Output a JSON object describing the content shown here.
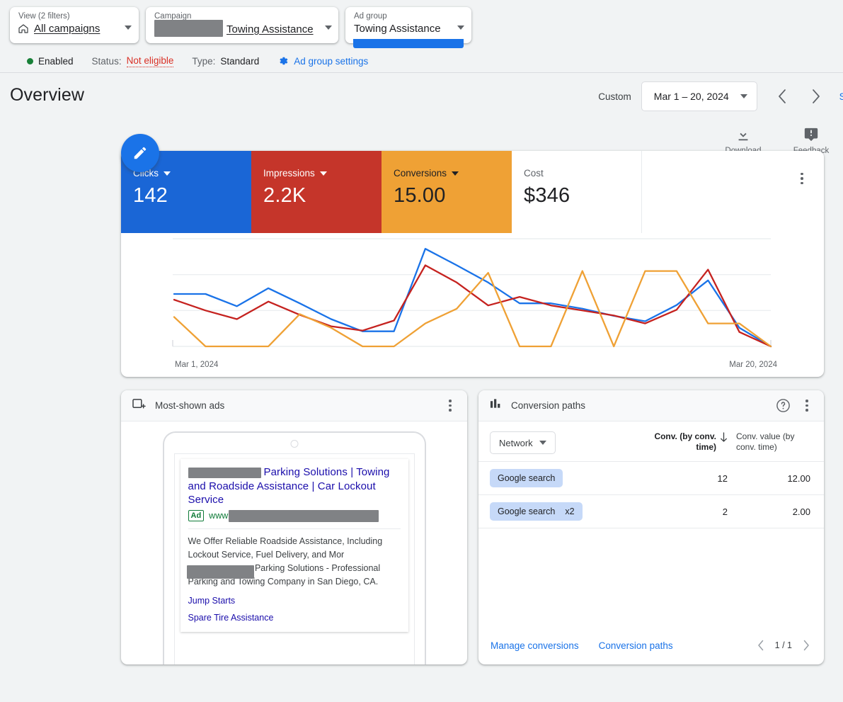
{
  "topbar": {
    "selectors": [
      {
        "label": "View (2 filters)",
        "value": "All campaigns",
        "icon": "home-icon",
        "underline": true,
        "redacted": false
      },
      {
        "label": "Campaign",
        "value": "Towing Assistance",
        "icon": "none",
        "underline": true,
        "redacted": true
      },
      {
        "label": "Ad group",
        "value": "Towing Assistance",
        "icon": "none",
        "underline": false,
        "redacted": false
      }
    ]
  },
  "status": {
    "enabled_label": "Enabled",
    "status_prefix": "Status:",
    "status_value": "Not eligible",
    "type_prefix": "Type:",
    "type_value": "Standard",
    "settings_label": "Ad group settings"
  },
  "header": {
    "title": "Overview",
    "custom_label": "Custom",
    "date_range": "Mar 1 – 20, 2024",
    "cut_off_link": "S"
  },
  "actions": {
    "download_label": "Download",
    "feedback_label": "Feedback",
    "edit_fab": "edit-pencil"
  },
  "scorecards": [
    {
      "label": "Clicks",
      "value": "142",
      "color": "#1a66d6",
      "text_color": "#ffffff",
      "has_caret": true
    },
    {
      "label": "Impressions",
      "value": "2.2K",
      "color": "#c5352a",
      "text_color": "#ffffff",
      "has_caret": true
    },
    {
      "label": "Conversions",
      "value": "15.00",
      "color": "#efa135",
      "text_color": "#202124",
      "has_caret": true
    },
    {
      "label": "Cost",
      "value": "$346",
      "color": "#ffffff",
      "text_color": "#202124",
      "has_caret": false
    }
  ],
  "chart_data": {
    "type": "line",
    "title": "",
    "xlabel": "",
    "ylabel": "",
    "grid": true,
    "legend_position": "none",
    "x_tick_labels": [
      "Mar 1, 2024",
      "Mar 20, 2024"
    ],
    "x": [
      "Mar 1",
      "Mar 2",
      "Mar 3",
      "Mar 4",
      "Mar 5",
      "Mar 6",
      "Mar 7",
      "Mar 8",
      "Mar 9",
      "Mar 10",
      "Mar 11",
      "Mar 12",
      "Mar 13",
      "Mar 14",
      "Mar 15",
      "Mar 16",
      "Mar 17",
      "Mar 18",
      "Mar 19",
      "Mar 20"
    ],
    "ylim": [
      0,
      3
    ],
    "gridline_values": [
      0,
      1,
      2,
      3
    ],
    "series": [
      {
        "name": "Clicks",
        "color": "#1a73e8",
        "values": [
          1.46,
          1.46,
          1.12,
          1.62,
          1.2,
          0.76,
          0.42,
          0.42,
          2.72,
          2.26,
          1.78,
          1.2,
          1.2,
          1.05,
          0.85,
          0.7,
          1.15,
          1.84,
          0.52,
          0.0
        ]
      },
      {
        "name": "Impressions",
        "color": "#c5221f",
        "values": [
          1.3,
          1.0,
          0.76,
          1.25,
          0.88,
          0.56,
          0.44,
          0.72,
          2.26,
          1.78,
          1.14,
          1.38,
          1.14,
          1.0,
          0.86,
          0.64,
          1.02,
          2.14,
          0.4,
          0.0
        ]
      },
      {
        "name": "Conversions",
        "color": "#efa135",
        "values": [
          0.82,
          0.0,
          0.0,
          0.0,
          0.9,
          0.52,
          0.0,
          0.0,
          0.64,
          1.05,
          2.05,
          0.0,
          0.0,
          2.1,
          0.0,
          2.1,
          2.1,
          0.64,
          0.64,
          0.0
        ]
      }
    ]
  },
  "ads_panel": {
    "title": "Most-shown ads",
    "icon": "ad-preview-icon",
    "ad": {
      "headline": "Parking Solutions | Towing and Roadside Assistance | Car Lockout Service",
      "badge": "Ad",
      "url_prefix": "www",
      "description": "We Offer Reliable Roadside Assistance, Including Lockout Service, Fuel Delivery, and More. Parking Solutions - Professional Parking and Towing Company in San Diego, CA.",
      "sitelinks": [
        "Jump Starts",
        "Spare Tire Assistance"
      ]
    }
  },
  "paths_panel": {
    "title": "Conversion paths",
    "icon": "bar-chart-icon",
    "filter_label": "Network",
    "columns": [
      {
        "label": "Conv. (by conv. time)",
        "sorted": true,
        "sort_dir": "desc"
      },
      {
        "label": "Conv. value (by conv. time)",
        "sorted": false
      }
    ],
    "rows": [
      {
        "network": "Google search",
        "multiplier": "",
        "conv": "12",
        "conv_value": "12.00"
      },
      {
        "network": "Google search",
        "multiplier": "x2",
        "conv": "2",
        "conv_value": "2.00"
      }
    ],
    "footer": {
      "manage_label": "Manage conversions",
      "paths_label": "Conversion paths",
      "page_indicator": "1 / 1"
    }
  }
}
